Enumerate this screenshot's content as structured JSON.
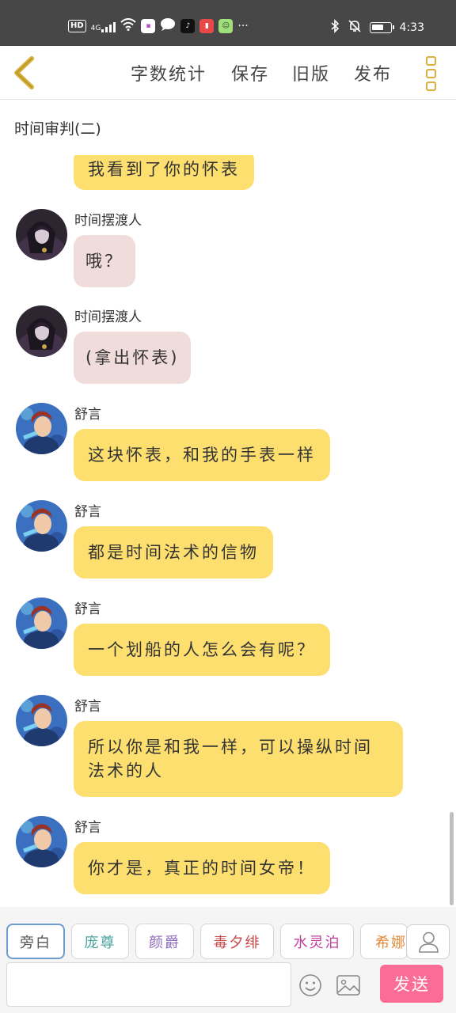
{
  "status_bar": {
    "hd": "HD",
    "network": "4G",
    "time": "4:33",
    "icons": [
      "signal-icon",
      "wifi-icon",
      "app-icon",
      "chat-bubble-icon",
      "tiktok-icon",
      "red-app-icon",
      "app-icon",
      "more-icon",
      "bluetooth-icon",
      "mute-icon",
      "battery-icon"
    ],
    "more": "···"
  },
  "toolbar": {
    "word_count": "字数统计",
    "save": "保存",
    "old_version": "旧版",
    "publish": "发布",
    "accent_color": "#d7b13b"
  },
  "title": "时间审判(二)",
  "messages": [
    {
      "sender": "",
      "text": "我看到了你的怀表",
      "style": "yellow",
      "avatar": "shuyan"
    },
    {
      "sender": "时间摆渡人",
      "text": "哦？",
      "style": "pink",
      "avatar": "ferryman"
    },
    {
      "sender": "时间摆渡人",
      "text": "(拿出怀表)",
      "style": "pink",
      "avatar": "ferryman"
    },
    {
      "sender": "舒言",
      "text": "这块怀表，和我的手表一样",
      "style": "yellow",
      "avatar": "shuyan"
    },
    {
      "sender": "舒言",
      "text": "都是时间法术的信物",
      "style": "yellow",
      "avatar": "shuyan"
    },
    {
      "sender": "舒言",
      "text": "一个划船的人怎么会有呢？",
      "style": "yellow",
      "avatar": "shuyan"
    },
    {
      "sender": "舒言",
      "text": "所以你是和我一样，可以操纵时间法术的人",
      "line1": "所以你是和我一样，可以操纵时间",
      "line2": "法术的人",
      "style": "yellow",
      "avatar": "shuyan"
    },
    {
      "sender": "舒言",
      "text": "你才是，真正的时间女帝！",
      "style": "yellow",
      "avatar": "shuyan"
    }
  ],
  "characters": [
    {
      "label": "旁白",
      "color": "#555555",
      "selected": true
    },
    {
      "label": "庞尊",
      "color": "#4aa3a0"
    },
    {
      "label": "颜爵",
      "color": "#8e6bb8"
    },
    {
      "label": "毒夕绯",
      "color": "#c94747"
    },
    {
      "label": "水灵泊",
      "color": "#c2409a"
    },
    {
      "label": "希娜",
      "color": "#e08a3c"
    }
  ],
  "input": {
    "value": "",
    "placeholder": ""
  },
  "send_label": "发送",
  "colors": {
    "bubble_yellow": "#fddf70",
    "bubble_pink": "#f1dcdc",
    "send": "#fb6d96"
  }
}
